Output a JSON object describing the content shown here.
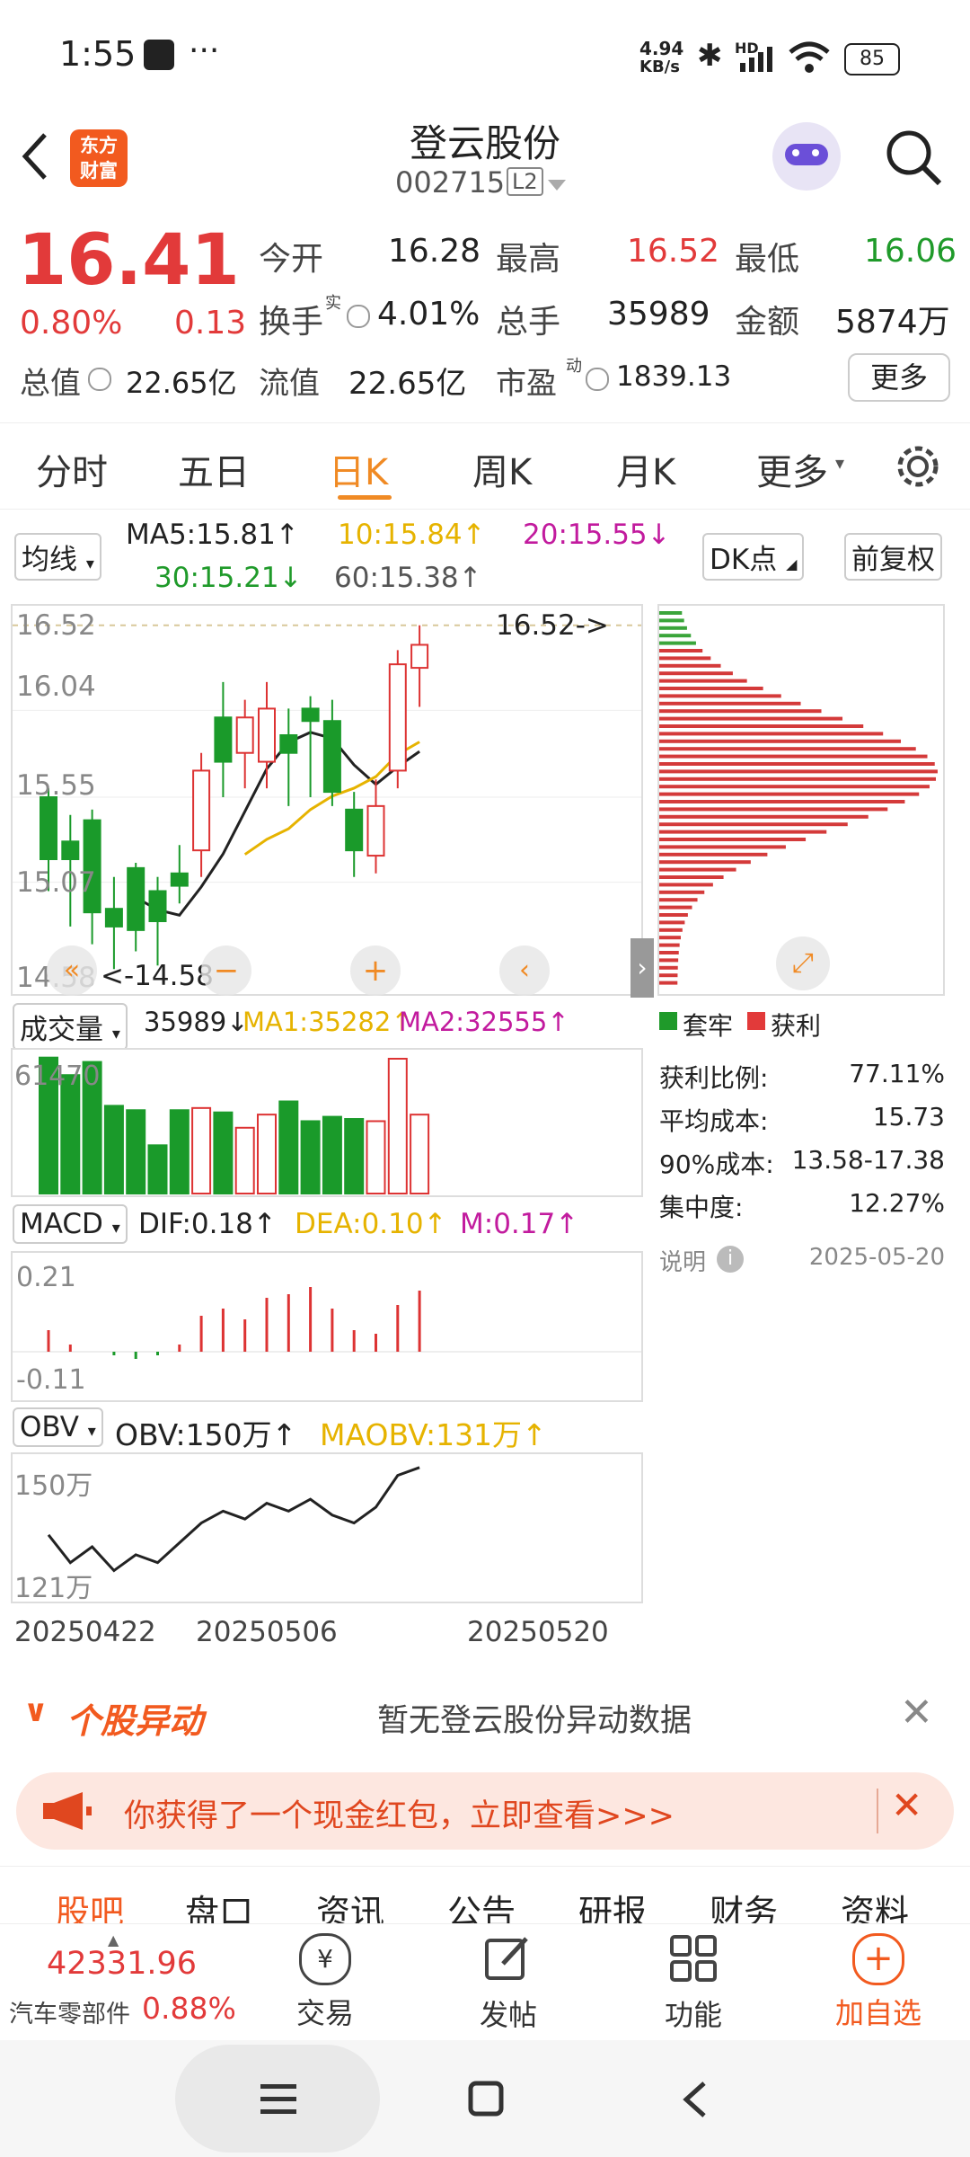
{
  "statusbar": {
    "time": "1:55",
    "dots": "···",
    "speed_top": "4.94",
    "speed_bottom": "KB/s",
    "signal": "HD",
    "battery": "85"
  },
  "header": {
    "logo_line1": "东方",
    "logo_line2": "财富",
    "title": "登云股份",
    "code": "002715",
    "level": "L2"
  },
  "quote": {
    "price": "16.41",
    "pct": "0.80%",
    "chg": "0.13",
    "open_label": "今开",
    "open": "16.28",
    "high_label": "最高",
    "high": "16.52",
    "low_label": "最低",
    "low": "16.06",
    "turnover_label": "换手",
    "turnover_sup": "实",
    "turnover": "4.01%",
    "vol_label": "总手",
    "vol": "35989",
    "amount_label": "金额",
    "amount": "5874万",
    "mcap_label": "总值",
    "mcap": "22.65亿",
    "float_label": "流值",
    "float": "22.65亿",
    "pe_label": "市盈",
    "pe_sup": "动",
    "pe": "1839.13",
    "more": "更多"
  },
  "tabs": {
    "t1": "分时",
    "t2": "五日",
    "t3": "日K",
    "t4": "周K",
    "t5": "月K",
    "t6": "更多"
  },
  "ma": {
    "select": "均线",
    "ma5": "MA5:15.81↑",
    "ma10": "10:15.84↑",
    "ma20": "20:15.55↓",
    "ma30": "30:15.21↓",
    "ma60": "60:15.38↑",
    "dk": "DK点",
    "fq": "前复权"
  },
  "kchart": {
    "y_top": "16.52",
    "y_mid1": "16.04",
    "y_mid2": "15.55",
    "y_mid3": "15.07",
    "y_bot": "14.58",
    "hi_anno": "16.52->",
    "lo_anno": "<-14.58"
  },
  "vol": {
    "select": "成交量",
    "v": "35989↓",
    "ma1": "MA1:35282↑",
    "ma2": "MA2:32555↑",
    "ymax": "61470"
  },
  "macd": {
    "select": "MACD",
    "dif": "DIF:0.18↑",
    "dea": "DEA:0.10↑",
    "m": "M:0.17↑",
    "ytop": "0.21",
    "ybot": "-0.11"
  },
  "obv": {
    "select": "OBV",
    "obv": "OBV:150万↑",
    "ma": "MAOBV:131万↑",
    "ytop": "150万",
    "ybot": "121万"
  },
  "dates": {
    "d1": "20250422",
    "d2": "20250506",
    "d3": "20250520"
  },
  "chip": {
    "legend1": "套牢",
    "legend2": "获利",
    "r1_label": "获利比例:",
    "r1": "77.11%",
    "r2_label": "平均成本:",
    "r2": "15.73",
    "r3_label": "90%成本:",
    "r3": "13.58-17.38",
    "r4_label": "集中度:",
    "r4": "12.27%",
    "note": "说明",
    "date": "2025-05-20"
  },
  "alert": {
    "title": "个股异动",
    "text": "暂无登云股份异动数据"
  },
  "promo": {
    "text": "你获得了一个现金红包，立即查看>>>"
  },
  "subtabs": [
    "股吧",
    "盘口",
    "资讯",
    "公告",
    "研报",
    "财务",
    "资料"
  ],
  "bottom": {
    "index": "42331.96",
    "sector": "汽车零部件",
    "sector_pct": "0.88%",
    "trade": "交易",
    "post": "发帖",
    "func": "功能",
    "add": "加自选"
  },
  "chart_data": {
    "type": "candlestick",
    "ohlc": [
      [
        15.55,
        15.6,
        15.02,
        15.2
      ],
      [
        15.3,
        15.45,
        14.82,
        15.2
      ],
      [
        15.42,
        15.48,
        14.72,
        14.9
      ],
      [
        14.92,
        15.1,
        14.58,
        14.82
      ],
      [
        15.15,
        15.18,
        14.68,
        14.8
      ],
      [
        15.02,
        15.1,
        14.6,
        14.85
      ],
      [
        15.12,
        15.28,
        14.95,
        15.05
      ],
      [
        15.25,
        15.8,
        15.1,
        15.7
      ],
      [
        16.0,
        16.2,
        15.55,
        15.75
      ],
      [
        15.8,
        16.1,
        15.6,
        16.0
      ],
      [
        15.75,
        16.2,
        15.6,
        16.05
      ],
      [
        15.9,
        16.05,
        15.5,
        15.8
      ],
      [
        16.05,
        16.12,
        15.55,
        15.98
      ],
      [
        15.98,
        16.1,
        15.5,
        15.58
      ],
      [
        15.48,
        15.58,
        15.1,
        15.25
      ],
      [
        15.22,
        15.65,
        15.12,
        15.5
      ],
      [
        15.7,
        16.38,
        15.6,
        16.3
      ],
      [
        16.28,
        16.52,
        16.06,
        16.41
      ]
    ],
    "volume": [
      62000,
      54000,
      60000,
      40000,
      38000,
      22000,
      38000,
      39000,
      37000,
      30000,
      36000,
      42000,
      33000,
      35000,
      34000,
      33000,
      61470,
      35989
    ],
    "macd_hist": [
      0.06,
      0.02,
      0.0,
      -0.01,
      -0.02,
      -0.01,
      0.02,
      0.1,
      0.12,
      0.09,
      0.15,
      0.16,
      0.18,
      0.12,
      0.06,
      0.05,
      0.13,
      0.17
    ],
    "obv_wan": [
      133,
      126,
      130,
      124,
      128,
      126,
      131,
      136,
      139,
      137,
      141,
      139,
      142,
      138,
      136,
      140,
      148,
      150
    ]
  }
}
